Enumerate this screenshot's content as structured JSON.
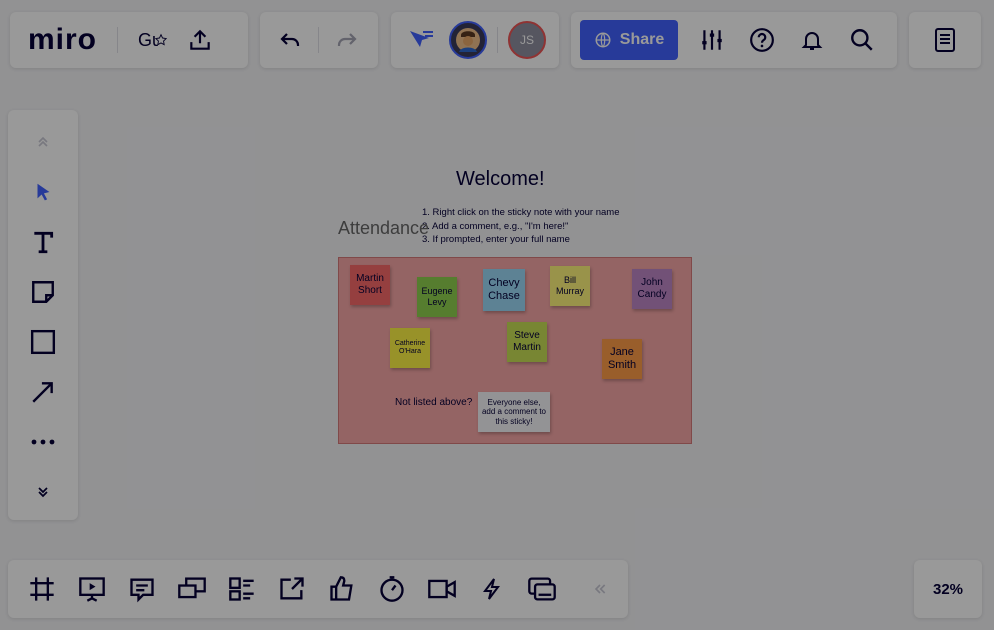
{
  "app": {
    "logo": "miro",
    "board_name": "Gu"
  },
  "header": {
    "share_label": "Share",
    "collaborator_initials": "JS"
  },
  "icons": {
    "upload": "upload-icon",
    "undo": "undo-icon",
    "redo": "redo-icon",
    "cursor": "cursor-follow-icon",
    "settings": "sliders-icon",
    "help": "help-icon",
    "bell": "bell-icon",
    "search": "search-icon",
    "notes": "notes-icon",
    "globe": "globe-icon"
  },
  "colors": {
    "brand": "#4262ff",
    "frame_bg": "#f7a7a7",
    "overlay": "rgba(0,0,0,0.4)"
  },
  "board": {
    "welcome": "Welcome!",
    "instructions": [
      "1. Right click on the sticky note with your name",
      "2. Add a comment, e.g., \"I'm here!\"",
      "3. If prompted, enter your full name"
    ],
    "attendance_label": "Attendance",
    "not_listed": "Not listed above?",
    "stickies": [
      {
        "label": "Martin Short",
        "color": "#f86a6a"
      },
      {
        "label": "Eugene Levy",
        "color": "#8fd14f"
      },
      {
        "label": "Chevy Chase",
        "color": "#9bd9f7"
      },
      {
        "label": "Bill Murray",
        "color": "#fff67c"
      },
      {
        "label": "John Candy",
        "color": "#be88c7"
      },
      {
        "label": "Catherine O'Hara",
        "color": "#fef445"
      },
      {
        "label": "Steve Martin",
        "color": "#c9df56"
      },
      {
        "label": "Jane Smith",
        "color": "#ff9d48"
      },
      {
        "label": "Everyone else, add a comment to this sticky!",
        "color": "#f5f6f8"
      }
    ]
  },
  "zoom": {
    "level": "32%"
  }
}
